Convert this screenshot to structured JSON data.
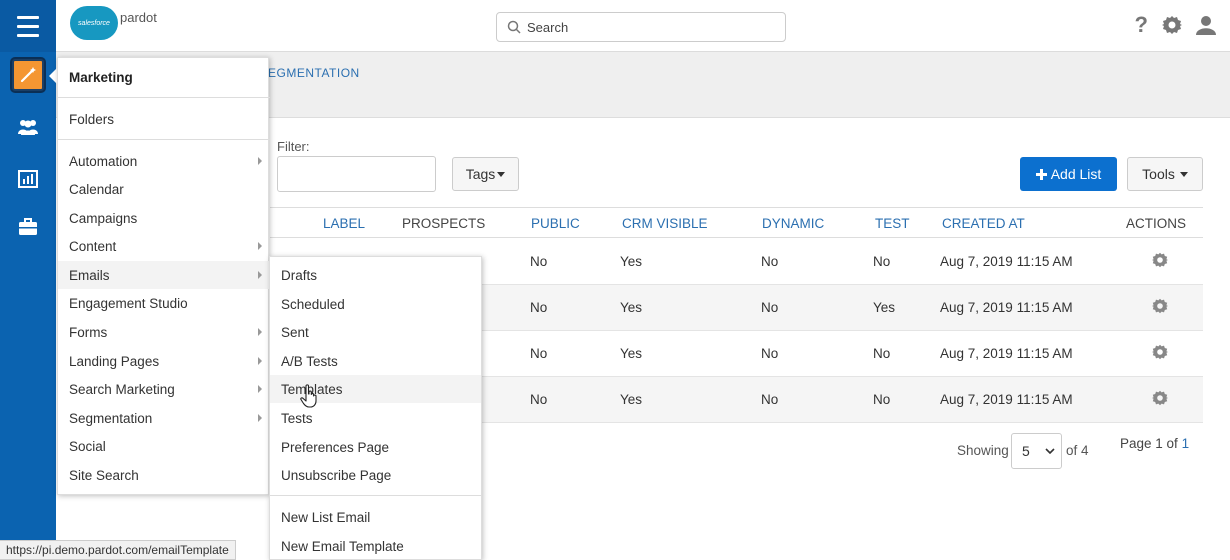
{
  "header": {
    "logo_cloud": "salesforce",
    "logo_text": "pardot",
    "search_placeholder": "Search",
    "help_label": "?"
  },
  "page": {
    "breadcrumb": "EGMENTATION"
  },
  "filter": {
    "label": "Filter:",
    "value": ""
  },
  "toolbar": {
    "tags_label": "Tags",
    "add_list_label": "Add List",
    "tools_label": "Tools"
  },
  "table": {
    "headers": {
      "label": "LABEL",
      "prospects": "PROSPECTS",
      "public": "PUBLIC",
      "crm_visible": "CRM VISIBLE",
      "dynamic": "DYNAMIC",
      "test": "TEST",
      "created_at": "CREATED AT",
      "actions": "ACTIONS"
    },
    "rows": [
      {
        "public": "No",
        "crm_visible": "Yes",
        "dynamic": "No",
        "test": "No",
        "created_at": "Aug 7, 2019 11:15 AM"
      },
      {
        "public": "No",
        "crm_visible": "Yes",
        "dynamic": "No",
        "test": "Yes",
        "created_at": "Aug 7, 2019 11:15 AM"
      },
      {
        "public": "No",
        "crm_visible": "Yes",
        "dynamic": "No",
        "test": "No",
        "created_at": "Aug 7, 2019 11:15 AM"
      },
      {
        "public": "No",
        "crm_visible": "Yes",
        "dynamic": "No",
        "test": "No",
        "created_at": "Aug 7, 2019 11:15 AM"
      }
    ]
  },
  "pagination": {
    "showing_label": "Showing",
    "page_size": "5",
    "of_total": "of 4",
    "page_label": "Page 1 of",
    "page_total": "1"
  },
  "menu": {
    "title": "Marketing",
    "items": [
      "Folders",
      "Automation",
      "Calendar",
      "Campaigns",
      "Content",
      "Emails",
      "Engagement Studio",
      "Forms",
      "Landing Pages",
      "Search Marketing",
      "Segmentation",
      "Social",
      "Site Search"
    ]
  },
  "submenu": {
    "items": [
      "Drafts",
      "Scheduled",
      "Sent",
      "A/B Tests",
      "Templates",
      "Tests",
      "Preferences Page",
      "Unsubscribe Page",
      "New List Email",
      "New Email Template"
    ]
  },
  "statusbar": {
    "url": "https://pi.demo.pardot.com/emailTemplate"
  },
  "colors": {
    "nav_blue": "#0b63b0",
    "accent_orange": "#f49632",
    "primary_button": "#0c70cf",
    "link_blue": "#2b6fb0"
  }
}
